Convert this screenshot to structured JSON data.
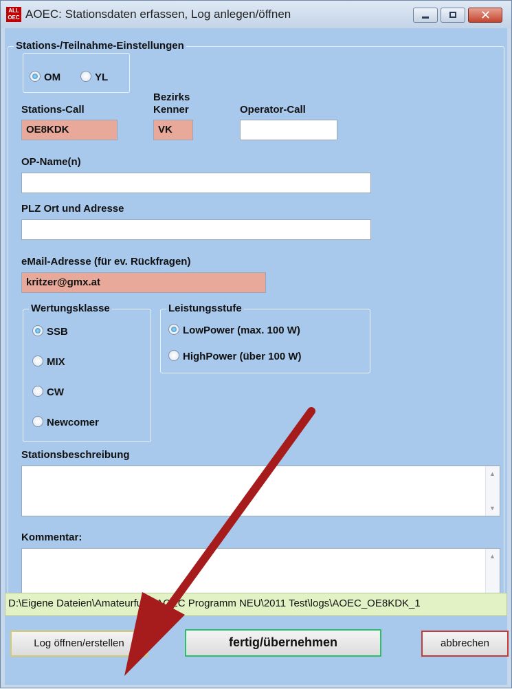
{
  "window": {
    "app_icon_text": "ALL OEC",
    "title": "AOEC: Stationsdaten erfassen, Log anlegen/öffnen"
  },
  "settings_group": {
    "legend": "Stations-/Teilnahme-Einstellungen",
    "gender_options": [
      "OM",
      "YL"
    ],
    "gender_selected": "OM"
  },
  "fields": {
    "station_call_label": "Stations-Call",
    "station_call_value": "OE8KDK",
    "district_label_line1": "Bezirks",
    "district_label_line2": "Kenner",
    "district_value": "VK",
    "operator_call_label": "Operator-Call",
    "operator_call_value": "",
    "op_name_label": "OP-Name(n)",
    "op_name_value": "",
    "address_label": "PLZ Ort und Adresse",
    "address_value": "",
    "email_label": "eMail-Adresse (für ev. Rückfragen)",
    "email_value": "kritzer@gmx.at"
  },
  "wertungsklasse": {
    "legend": "Wertungsklasse",
    "options": [
      "SSB",
      "MIX",
      "CW",
      "Newcomer"
    ],
    "selected": "SSB"
  },
  "leistungsstufe": {
    "legend": "Leistungsstufe",
    "options": [
      "LowPower (max. 100 W)",
      "HighPower (über 100 W)"
    ],
    "selected": "LowPower (max. 100 W)"
  },
  "description": {
    "label": "Stationsbeschreibung",
    "value": ""
  },
  "comment": {
    "label": "Kommentar:",
    "value": ""
  },
  "path": "D:\\Eigene Dateien\\Amateurfunk\\AOEC Programm NEU\\2011 Test\\logs\\AOEC_OE8KDK_1",
  "buttons": {
    "log_open": "Log öffnen/erstellen",
    "done": "fertig/übernehmen",
    "cancel": "abbrechen"
  },
  "colors": {
    "client_bg": "#a9c9ec",
    "required_field": "#e8a99b",
    "path_bg": "#e2f2c4",
    "annotation_arrow": "#a61b1b"
  }
}
